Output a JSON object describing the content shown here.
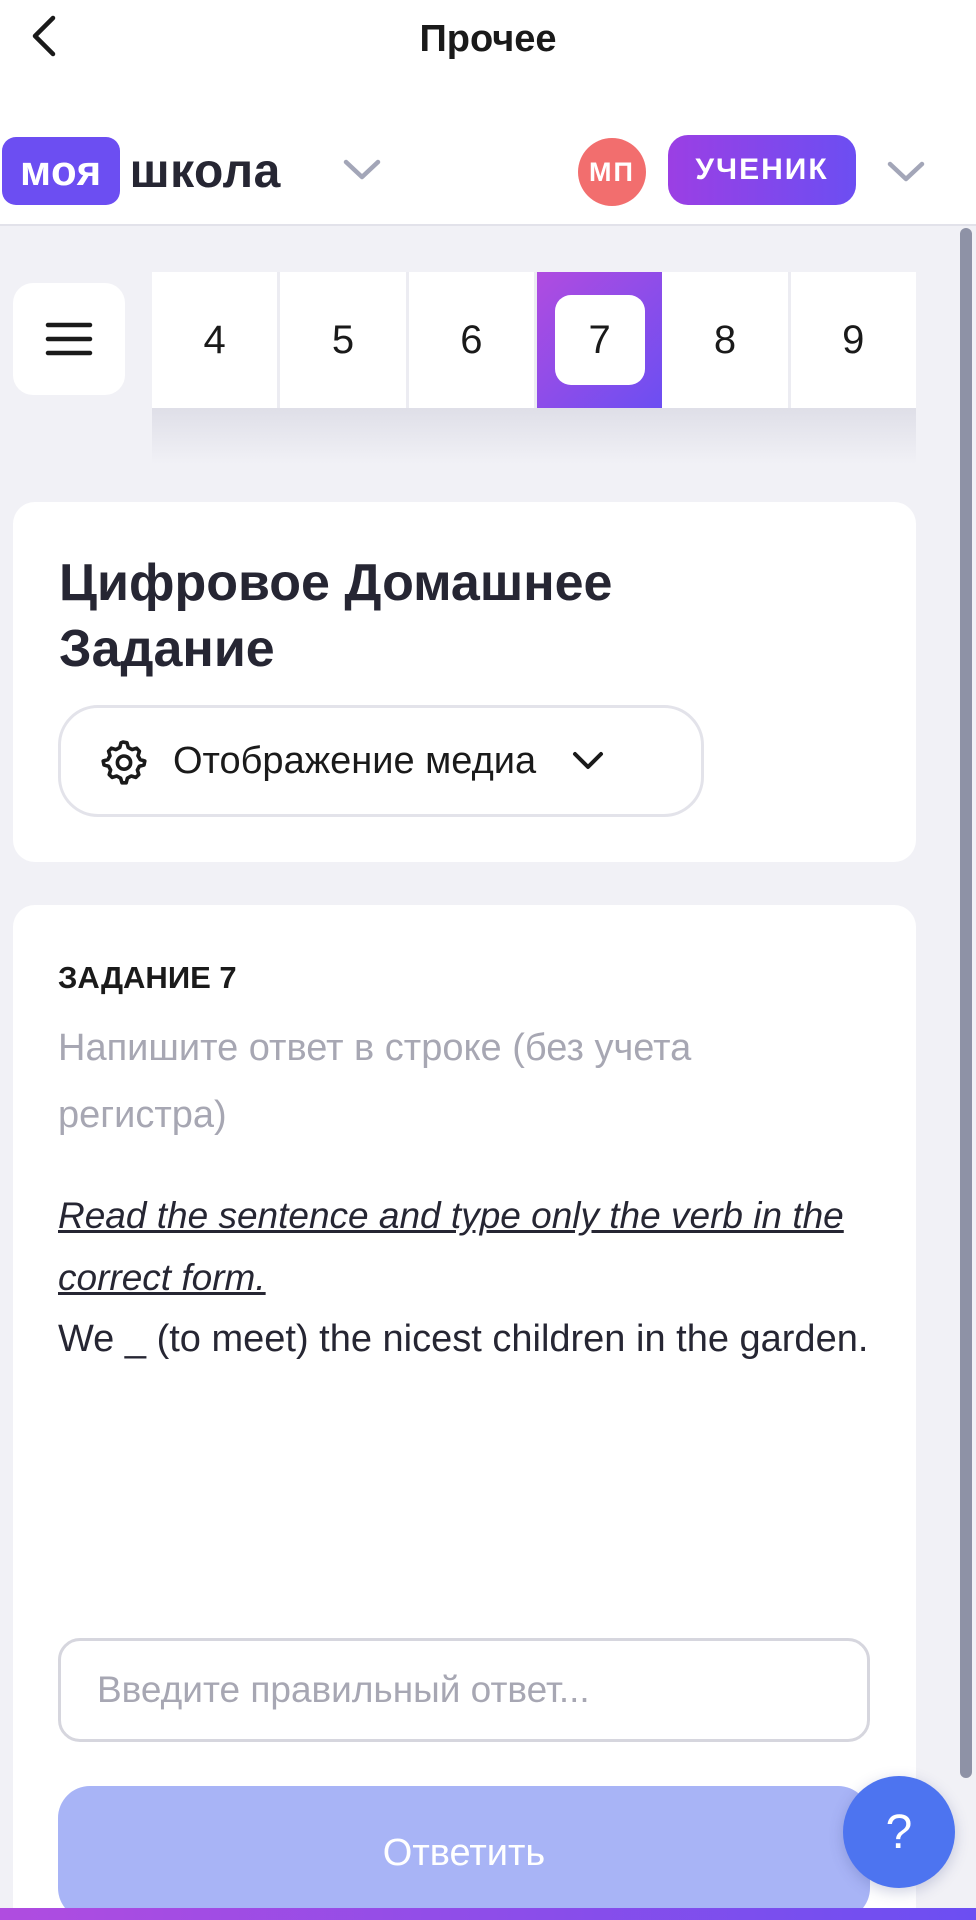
{
  "nav": {
    "title": "Прочее",
    "back_icon": "chevron-left-icon"
  },
  "header": {
    "logo_part1": "моя",
    "logo_part2": "школа",
    "avatar_initials": "МП",
    "role": "УЧЕНИК"
  },
  "tabs": {
    "items": [
      "4",
      "5",
      "6",
      "7",
      "8",
      "9"
    ],
    "active": "7"
  },
  "card": {
    "title": "Цифровое Домашнее Задание",
    "media_dropdown_label": "Отображение медиа"
  },
  "task": {
    "number_label": "ЗАДАНИЕ 7",
    "hint": "Напишите ответ в строке (без учета регистра)",
    "instruction": "Read the sentence and type only the verb in the correct form.",
    "sentence": "We _ (to meet) the nicest children in the garden.",
    "input_placeholder": "Введите правильный ответ...",
    "input_value": "",
    "submit_label": "Ответить"
  },
  "help": {
    "label": "?"
  },
  "colors": {
    "brand_purple": "#6c4ef2",
    "gradient_magenta": "#b04ce0",
    "avatar_red": "#f26e6e",
    "submit_disabled": "#a8b4f6",
    "help_blue": "#4d74f0"
  }
}
